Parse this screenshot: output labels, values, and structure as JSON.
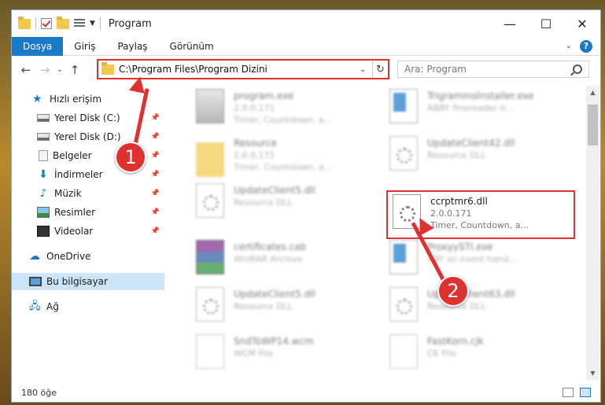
{
  "window": {
    "title": "Program"
  },
  "ribbon": {
    "tabs": [
      "Dosya",
      "Giriş",
      "Paylaş",
      "Görünüm"
    ]
  },
  "address": {
    "path": "C:\\Program Files\\Program Dizini"
  },
  "search": {
    "placeholder": "Ara: Program"
  },
  "sidebar": {
    "items": [
      {
        "label": "Hızlı erişim"
      },
      {
        "label": "Yerel Disk (C:)"
      },
      {
        "label": "Yerel Disk (D:)"
      },
      {
        "label": "Belgeler"
      },
      {
        "label": "İndirmeler"
      },
      {
        "label": "Müzik"
      },
      {
        "label": "Resimler"
      },
      {
        "label": "Videolar"
      },
      {
        "label": "OneDrive"
      },
      {
        "label": "Bu bilgisayar"
      },
      {
        "label": "Ağ"
      }
    ]
  },
  "files": [
    {
      "name": "program.exe",
      "l2": "2.0.0.171",
      "l3": "Timer, Countdown, a..."
    },
    {
      "name": "Trigrammslnstaller.exe",
      "l2": "ABBY finereader tr...",
      "l3": ""
    },
    {
      "name": "Resource",
      "l2": "2.0.0.171",
      "l3": "Timer, Countdown, a..."
    },
    {
      "name": "UpdateClient42.dll",
      "l2": "Resource DLL",
      "l3": ""
    },
    {
      "name": "UpdateClient5.dll",
      "l2": "Resource DLL",
      "l3": ""
    },
    {
      "name": "ccrptmr6.dll",
      "l2": "2.0.0.171",
      "l3": "Timer, Countdown, a..."
    },
    {
      "name": "certificates.cab",
      "l2": "WinRAR Archive",
      "l3": ""
    },
    {
      "name": "ProxyySTI.exe",
      "l2": "ABY sti event hand...",
      "l3": ""
    },
    {
      "name": "UpdateClient5.dll",
      "l2": "Resource DLL",
      "l3": ""
    },
    {
      "name": "UpdateClient63.dll",
      "l2": "Resource DLL",
      "l3": ""
    },
    {
      "name": "SndToWP14.wcm",
      "l2": "WCM File",
      "l3": ""
    },
    {
      "name": "FastKorn.cjk",
      "l2": "CK File",
      "l3": ""
    }
  ],
  "status": {
    "count": "180 öğe"
  },
  "annotations": {
    "badge1": "1",
    "badge2": "2"
  },
  "colors": {
    "accent": "#1979ca",
    "highlight": "#e03131",
    "selected": "#cce4f7"
  }
}
